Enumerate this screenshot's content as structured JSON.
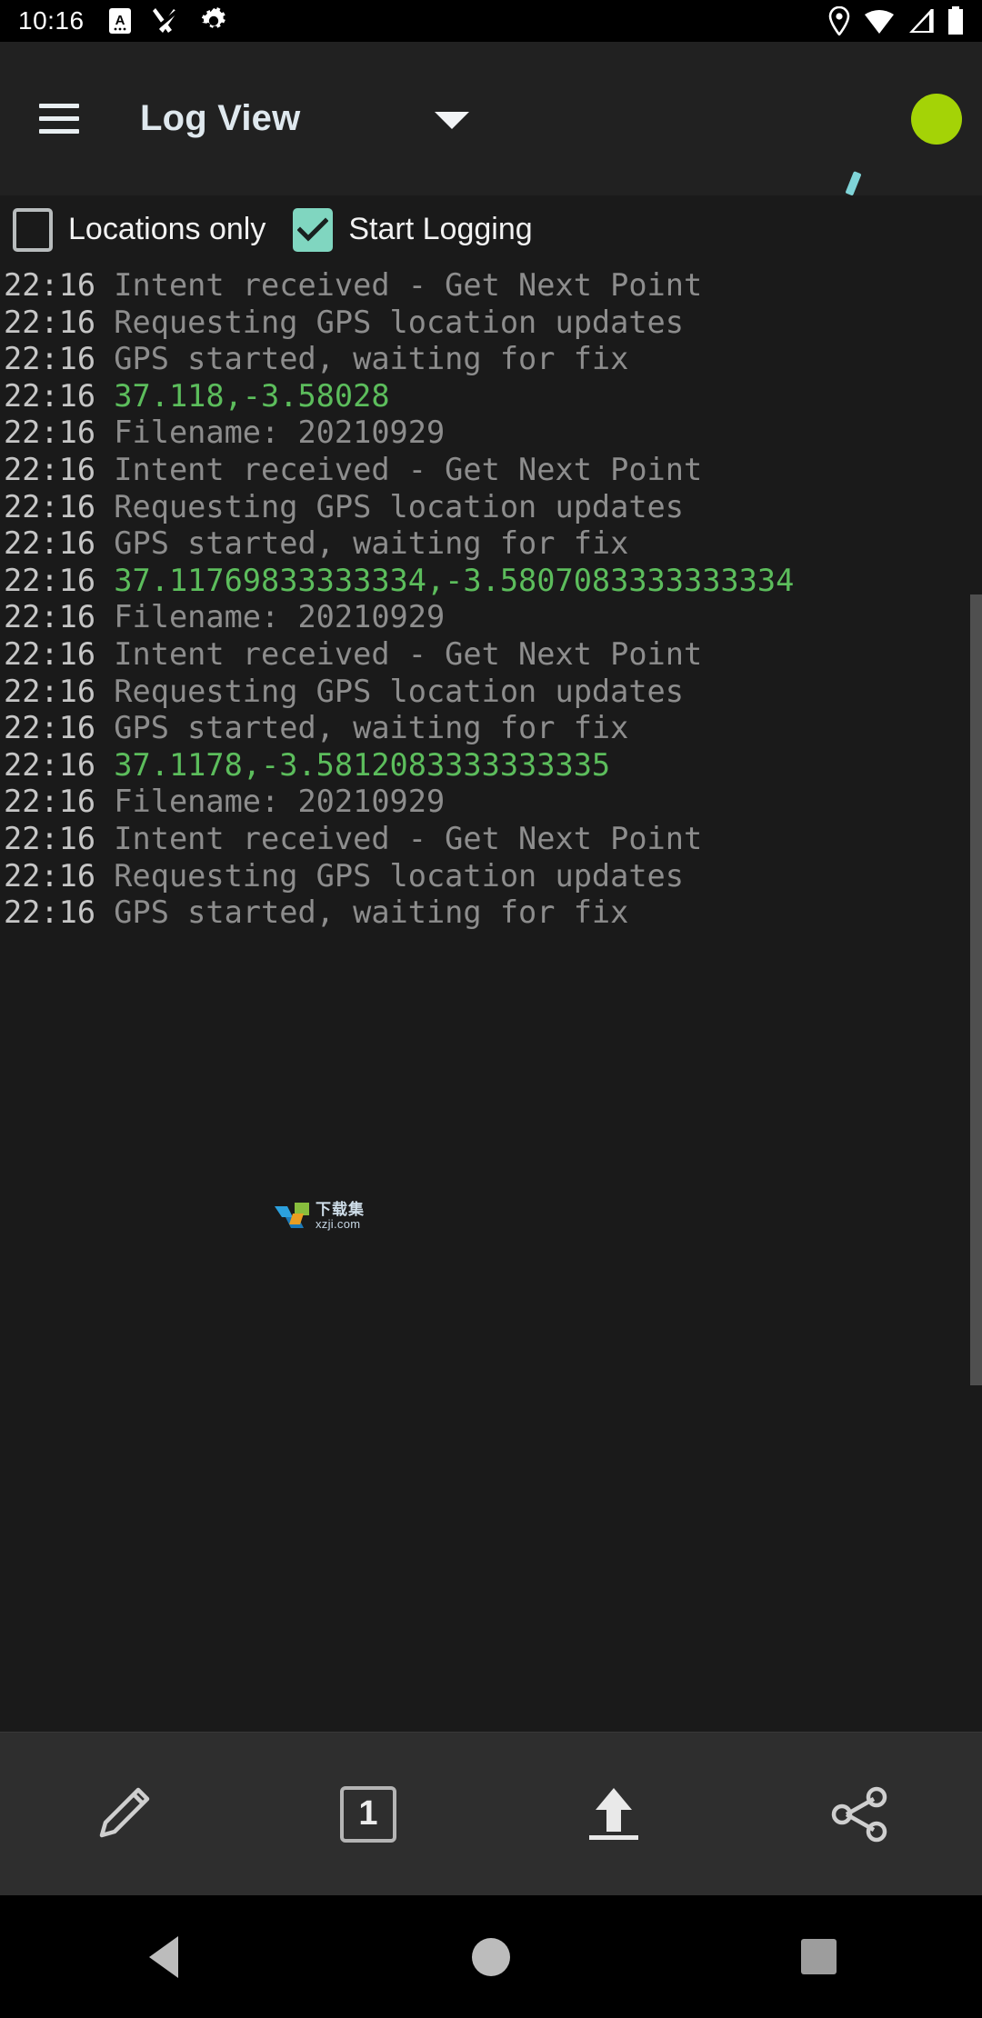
{
  "status_bar": {
    "time": "10:16",
    "left_icons": [
      "a-badge-icon",
      "scissors-off-icon",
      "gear-icon"
    ],
    "right_icons": [
      "location-pin-icon",
      "wifi-icon",
      "signal-icon",
      "battery-icon"
    ]
  },
  "app_bar": {
    "menu_icon": "hamburger-menu-icon",
    "title": "Log View",
    "dropdown_icon": "chevron-down-icon",
    "satellite_icon": "satellite-indicator-icon",
    "status_dot_color": "#a4d306",
    "satellite_icon_color": "#7fd4d8"
  },
  "options": {
    "locations_only": {
      "label": "Locations only",
      "checked": false
    },
    "start_logging": {
      "label": "Start Logging",
      "checked": true,
      "accent": "#80d6c0"
    }
  },
  "log": {
    "timestamp_color": "#c6c6c6",
    "message_color": "#8d8d8d",
    "coordinate_color": "#5cbd5c",
    "lines": [
      {
        "time": "22:16",
        "text": "Intent received - Get Next Point",
        "kind": "message"
      },
      {
        "time": "22:16",
        "text": "Requesting GPS location updates",
        "kind": "message"
      },
      {
        "time": "22:16",
        "text": "GPS started, waiting for fix",
        "kind": "message"
      },
      {
        "time": "22:16",
        "text": "37.118,-3.58028",
        "kind": "coordinate"
      },
      {
        "time": "22:16",
        "text": "Filename: 20210929",
        "kind": "message"
      },
      {
        "time": "22:16",
        "text": "Intent received - Get Next Point",
        "kind": "message"
      },
      {
        "time": "22:16",
        "text": "Requesting GPS location updates",
        "kind": "message"
      },
      {
        "time": "22:16",
        "text": "GPS started, waiting for fix",
        "kind": "message"
      },
      {
        "time": "22:16",
        "text": "37.11769833333334,-3.5807083333333334",
        "kind": "coordinate"
      },
      {
        "time": "22:16",
        "text": "Filename: 20210929",
        "kind": "message"
      },
      {
        "time": "22:16",
        "text": "Intent received - Get Next Point",
        "kind": "message"
      },
      {
        "time": "22:16",
        "text": "Requesting GPS location updates",
        "kind": "message"
      },
      {
        "time": "22:16",
        "text": "GPS started, waiting for fix",
        "kind": "message"
      },
      {
        "time": "22:16",
        "text": "37.1178,-3.5812083333333335",
        "kind": "coordinate"
      },
      {
        "time": "22:16",
        "text": "Filename: 20210929",
        "kind": "message"
      },
      {
        "time": "22:16",
        "text": "Intent received - Get Next Point",
        "kind": "message"
      },
      {
        "time": "22:16",
        "text": "Requesting GPS location updates",
        "kind": "message"
      },
      {
        "time": "22:16",
        "text": "GPS started, waiting for fix",
        "kind": "message"
      }
    ]
  },
  "watermark": {
    "title": "下载集",
    "url": "xzji.com"
  },
  "bottom_toolbar": {
    "items": [
      {
        "name": "edit-pencil-icon",
        "label": ""
      },
      {
        "name": "page-count-box",
        "label": "1"
      },
      {
        "name": "upload-icon",
        "label": ""
      },
      {
        "name": "share-icon",
        "label": ""
      }
    ],
    "page_count": "1"
  },
  "nav_bar": {
    "back": "back-triangle-icon",
    "home": "home-circle-icon",
    "recents": "recents-square-icon"
  }
}
